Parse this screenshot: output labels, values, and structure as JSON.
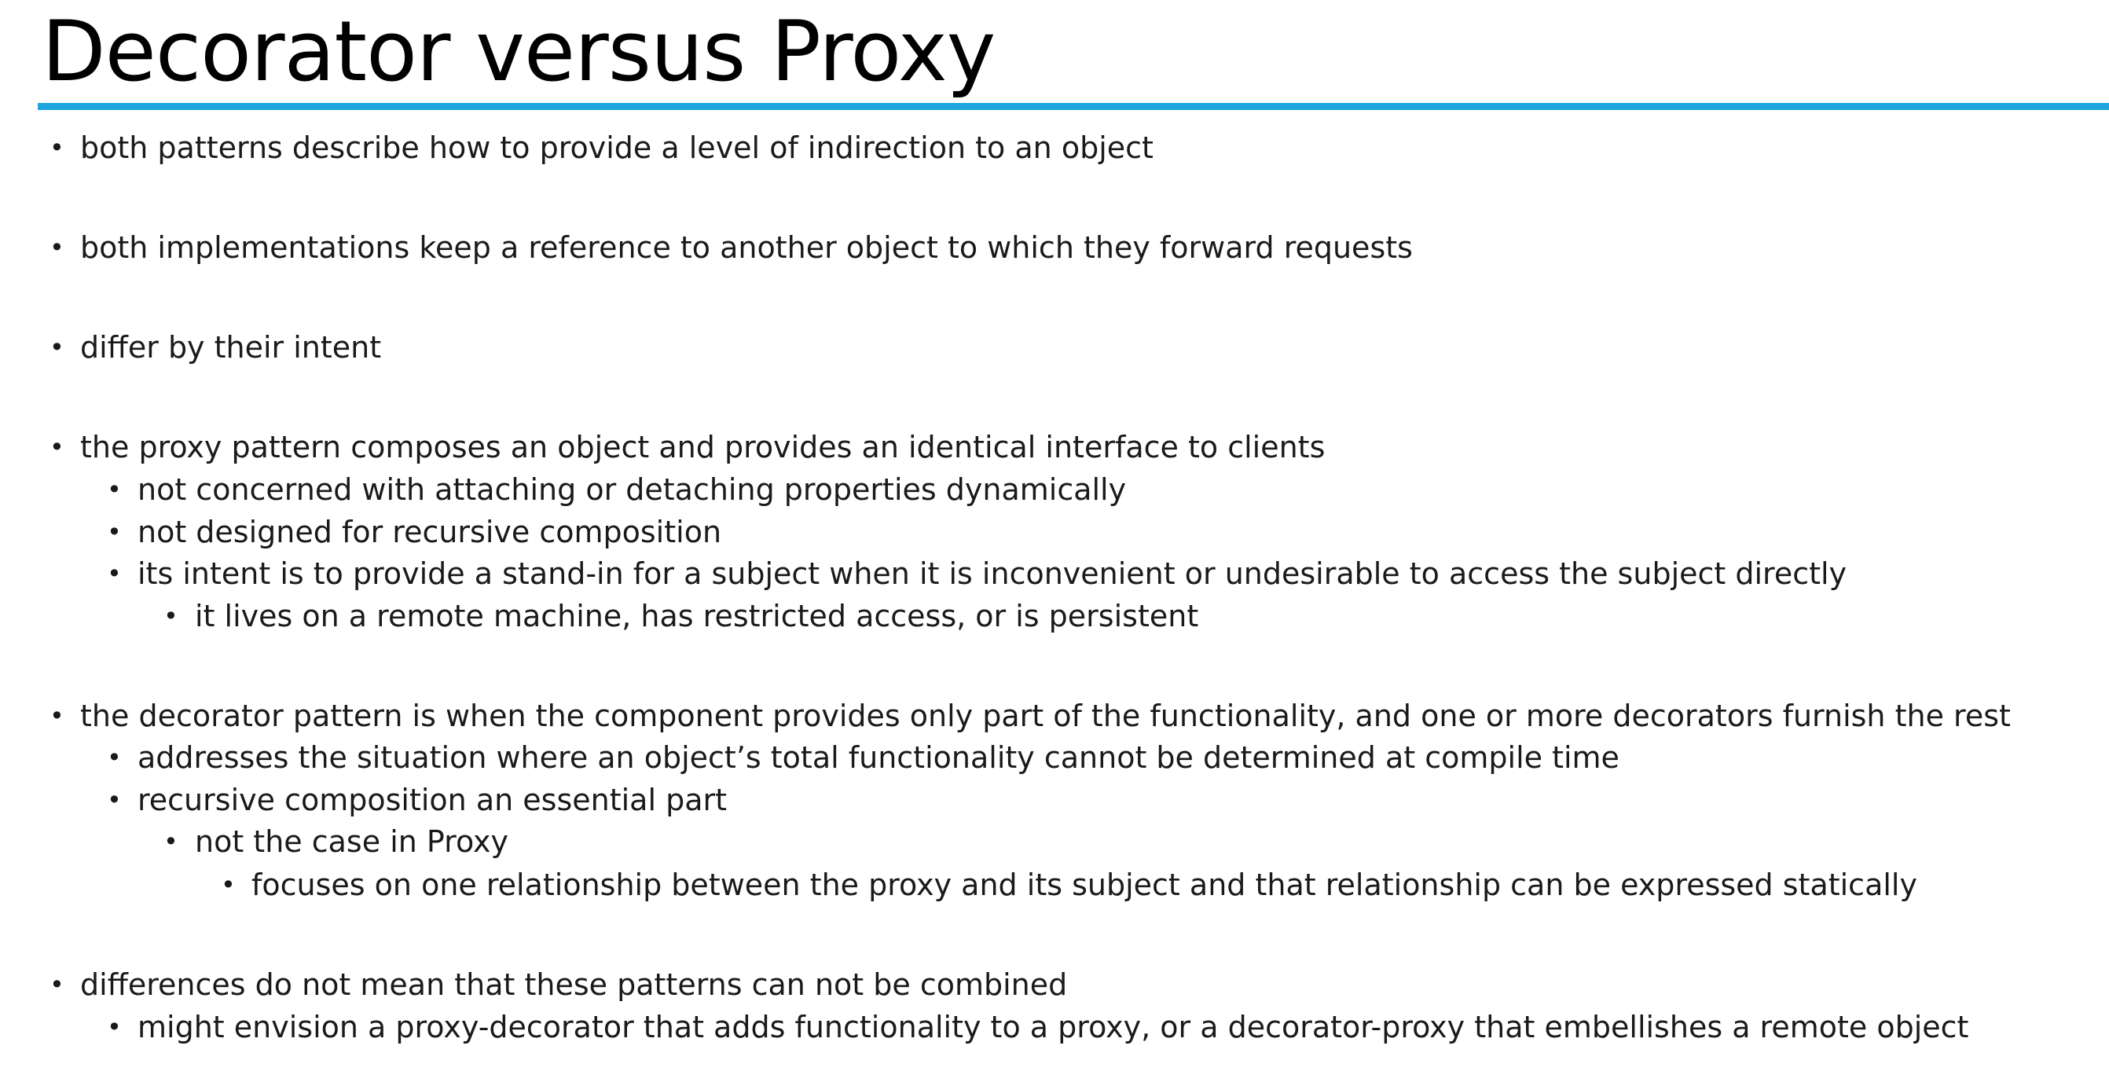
{
  "slide": {
    "title": "Decorator versus Proxy",
    "accent_color": "#1ea5dd",
    "bullet_glyph": "•",
    "bullets": [
      {
        "level": 1,
        "text": "both patterns describe how to provide a level of indirection to an object"
      },
      {
        "level": 1,
        "text": "both implementations keep a reference to another object to which they forward requests"
      },
      {
        "level": 1,
        "text": "differ by their intent"
      },
      {
        "level": 1,
        "text": "the proxy pattern composes an object and provides an identical interface to clients"
      },
      {
        "level": 2,
        "text": "not concerned with attaching or detaching properties dynamically"
      },
      {
        "level": 2,
        "text": "not designed for recursive composition"
      },
      {
        "level": 2,
        "text": "its intent is to provide a stand-in for a subject when it is inconvenient or undesirable to access the subject directly"
      },
      {
        "level": 3,
        "text": "it lives on a remote machine, has restricted access, or is persistent"
      },
      {
        "level": 1,
        "text": "the decorator pattern is when the component provides only part of the functionality, and one or more decorators furnish the rest"
      },
      {
        "level": 2,
        "text": "addresses the situation where an object’s total functionality cannot be determined at compile time"
      },
      {
        "level": 2,
        "text": "recursive composition an essential part"
      },
      {
        "level": 3,
        "text": "not the case in Proxy"
      },
      {
        "level": 4,
        "text": "focuses on one relationship between the proxy and its subject and that relationship can be expressed statically"
      },
      {
        "level": 1,
        "text": "differences do not mean that these patterns can not be combined"
      },
      {
        "level": 2,
        "text": "might envision a proxy-decorator that adds functionality to a proxy, or a decorator-proxy that embellishes a remote object"
      }
    ]
  }
}
